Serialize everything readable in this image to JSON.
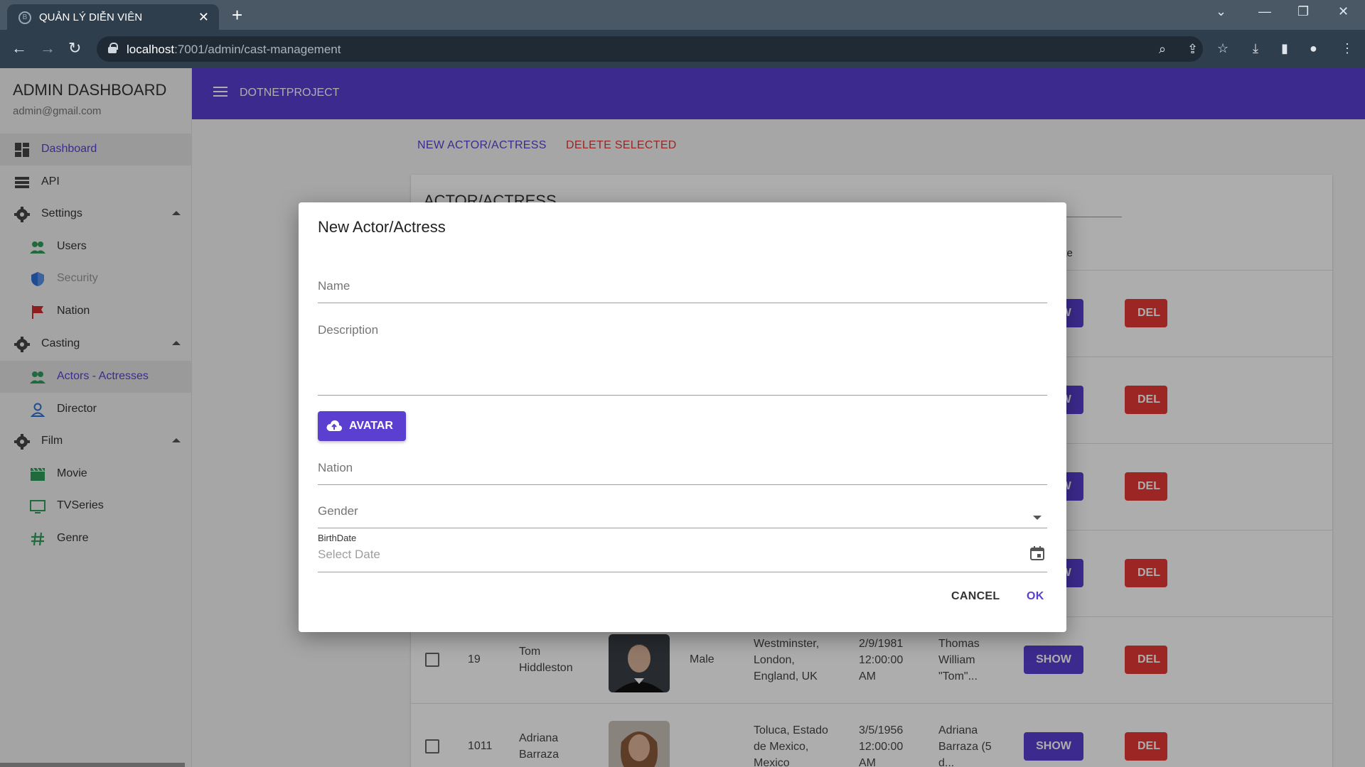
{
  "browser": {
    "tab_title": "QUẢN LÝ DIỄN VIÊN",
    "tab_close": "✕",
    "new_tab": "+",
    "url_host": "localhost",
    "url_path": ":7001/admin/cast-management"
  },
  "sidebar": {
    "title": "ADMIN DASHBOARD",
    "email": "admin@gmail.com",
    "items": [
      {
        "label": "Dashboard",
        "icon": "dashboard-icon",
        "color": "#5b3fd1"
      },
      {
        "label": "API",
        "icon": "list-icon",
        "color": "#333333"
      },
      {
        "label": "Settings",
        "icon": "gear-icon",
        "color": "#333333"
      },
      {
        "label": "Users",
        "icon": "users-icon",
        "color": "#333333"
      },
      {
        "label": "Security",
        "icon": "shield-icon",
        "color": "#999999"
      },
      {
        "label": "Nation",
        "icon": "flag-icon",
        "color": "#333333"
      },
      {
        "label": "Casting",
        "icon": "gear-icon",
        "color": "#333333"
      },
      {
        "label": "Actors - Actresses",
        "icon": "users-icon",
        "color": "#5b3fd1"
      },
      {
        "label": "Director",
        "icon": "person-icon",
        "color": "#333333"
      },
      {
        "label": "Film",
        "icon": "gear-icon",
        "color": "#333333"
      },
      {
        "label": "Movie",
        "icon": "clapper-icon",
        "color": "#333333"
      },
      {
        "label": "TVSeries",
        "icon": "tv-icon",
        "color": "#333333"
      },
      {
        "label": "Genre",
        "icon": "hash-icon",
        "color": "#333333"
      }
    ]
  },
  "appbar": {
    "brand": "DOTNETPROJECT"
  },
  "toolbar": {
    "new_label": "NEW ACTOR/ACTRESS",
    "delete_label": "DELETE SELECTED"
  },
  "table": {
    "title": "ACTOR/ACTRESS",
    "partial_header": "ate",
    "rows": [
      {
        "id": "19",
        "name": "Tom\nHiddleston",
        "gender": "Male",
        "place": "Westminster,\nLondon,\nEngland, UK",
        "date": "2/9/1981\n12:00:00\nAM",
        "desc": "Thomas\nWilliam\n\"Tom\"...",
        "show": "SHOW",
        "del": "DEL"
      },
      {
        "id": "1011",
        "name": "Adriana\nBarraza",
        "gender": "",
        "place": "Toluca, Estado\nde Mexico,\nMexico",
        "date": "3/5/1956\n12:00:00\nAM",
        "desc": "Adriana\nBarraza (5\nd...",
        "show": "SHOW",
        "del": "DEL"
      }
    ],
    "hidden_show": "SHOW",
    "hidden_del": "DEL"
  },
  "dialog": {
    "title": "New Actor/Actress",
    "name_placeholder": "Name",
    "description_placeholder": "Description",
    "avatar_label": "AVATAR",
    "nation_placeholder": "Nation",
    "gender_placeholder": "Gender",
    "birthdate_label": "BirthDate",
    "birthdate_placeholder": "Select Date",
    "cancel_label": "CANCEL",
    "ok_label": "OK"
  },
  "colors": {
    "primary": "#5b3fd1",
    "danger": "#e53935"
  }
}
